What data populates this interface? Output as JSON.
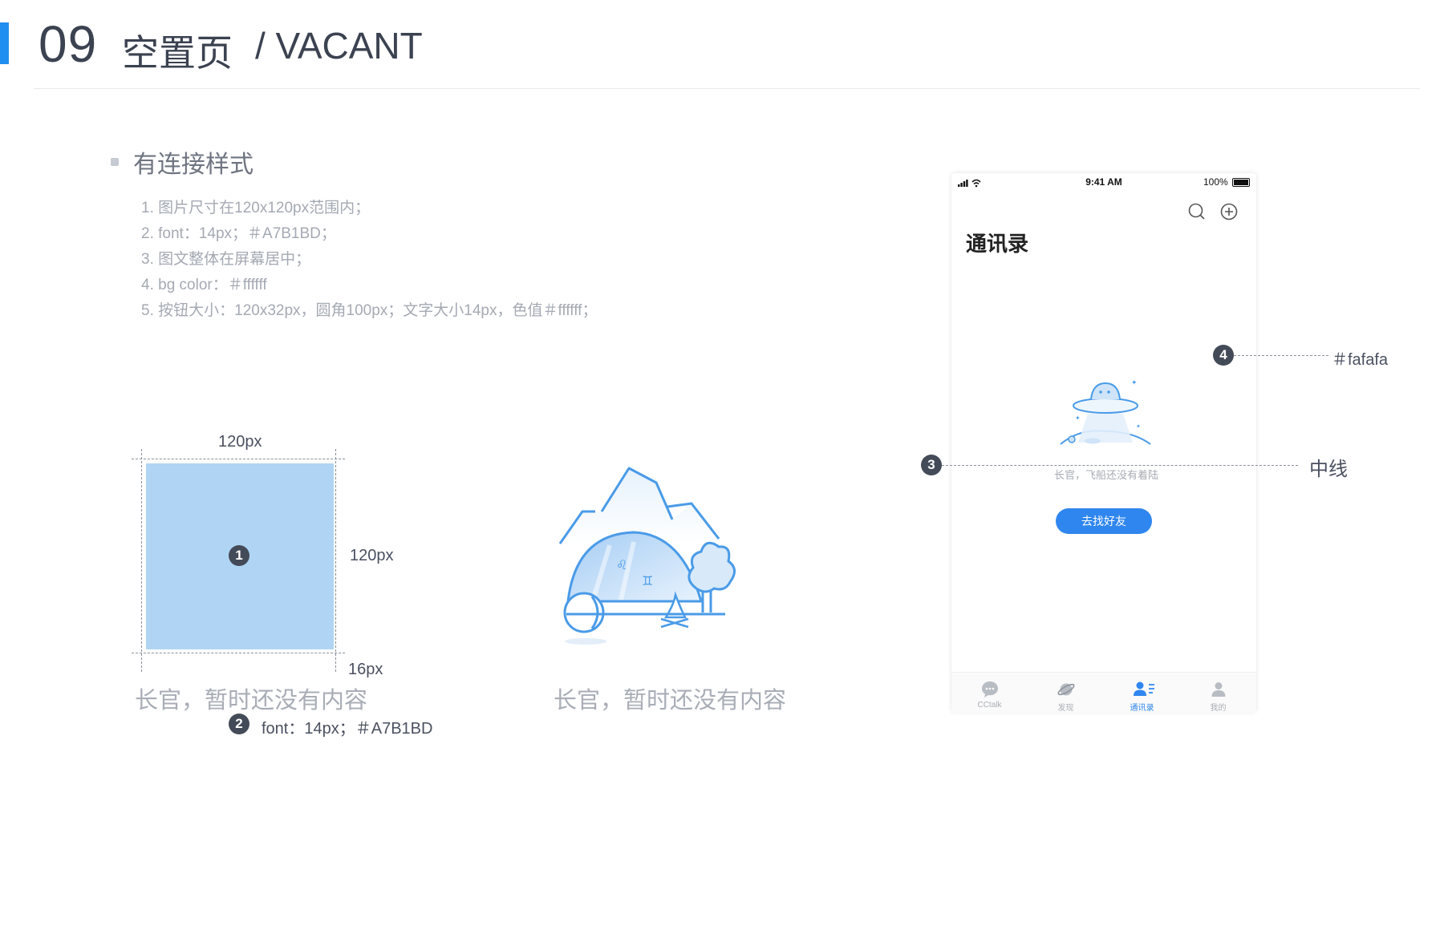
{
  "header": {
    "number": "09",
    "title": "空置页",
    "subtitle": "/ VACANT",
    "accent_color": "#1f8ff0"
  },
  "section": {
    "title": "有连接样式",
    "rules": [
      "1.  图片尺寸在120x120px范围内；",
      "2.  font：14px；＃A7B1BD；",
      "3.  图文整体在屏幕居中；",
      "4.  bg color：＃ffffff",
      "5.  按钮大小：120x32px，圆角100px；文字大小14px，色值＃ffffff；"
    ]
  },
  "spec": {
    "width_label": "120px",
    "height_label": "120px",
    "gap_label": "16px",
    "marker_1": "1",
    "marker_2": "2",
    "empty_text": "长官，暂时还没有内容",
    "font_note": "font：14px；＃A7B1BD",
    "box_color": "#b0d5f4"
  },
  "illustration": {
    "empty_text": "长官，暂时还没有内容"
  },
  "phone": {
    "status": {
      "time": "9:41 AM",
      "battery": "100%"
    },
    "title": "通讯录",
    "empty_text": "长官，飞船还没有着陆",
    "button_label": "去找好友",
    "button_color": "#2f86ee",
    "tabs": [
      {
        "label": "CCtalk",
        "icon": "chat-icon",
        "active": false
      },
      {
        "label": "发现",
        "icon": "planet-icon",
        "active": false
      },
      {
        "label": "通讯录",
        "icon": "contacts-icon",
        "active": true
      },
      {
        "label": "我的",
        "icon": "profile-icon",
        "active": false
      }
    ]
  },
  "annotations": {
    "marker_3": "3",
    "marker_4": "4",
    "bg_label": "＃fafafa",
    "midline_label": "中线"
  }
}
